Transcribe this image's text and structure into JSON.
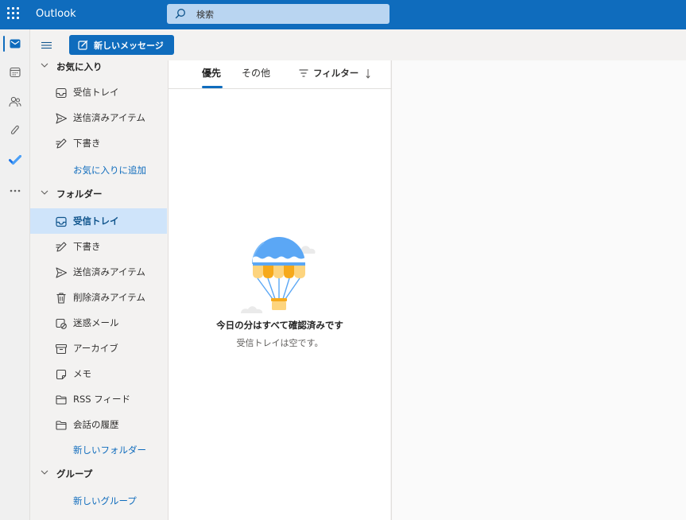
{
  "topbar": {
    "app_title": "Outlook",
    "search_placeholder": "検索",
    "bg_color": "#0f6cbd"
  },
  "rail": {
    "items": [
      {
        "name": "mail-icon",
        "active": true
      },
      {
        "name": "calendar-icon",
        "active": false
      },
      {
        "name": "people-icon",
        "active": false
      },
      {
        "name": "attachment-icon",
        "active": false
      },
      {
        "name": "todo-icon",
        "active": false
      },
      {
        "name": "more-apps-icon",
        "active": false
      }
    ]
  },
  "commands": {
    "new_message_label": "新しいメッセージ"
  },
  "folders": {
    "favorites_header": "お気に入り",
    "favorites": [
      {
        "label": "受信トレイ",
        "icon": "inbox-icon"
      },
      {
        "label": "送信済みアイテム",
        "icon": "send-icon"
      },
      {
        "label": "下書き",
        "icon": "drafts-icon"
      }
    ],
    "add_favorite_link": "お気に入りに追加",
    "folders_header": "フォルダー",
    "folder_items": [
      {
        "label": "受信トレイ",
        "icon": "inbox-icon",
        "selected": true
      },
      {
        "label": "下書き",
        "icon": "drafts-icon"
      },
      {
        "label": "送信済みアイテム",
        "icon": "send-icon"
      },
      {
        "label": "削除済みアイテム",
        "icon": "trash-icon"
      },
      {
        "label": "迷惑メール",
        "icon": "junk-icon"
      },
      {
        "label": "アーカイブ",
        "icon": "archive-icon"
      },
      {
        "label": "メモ",
        "icon": "notes-icon"
      },
      {
        "label": "RSS フィード",
        "icon": "folder-icon"
      },
      {
        "label": "会話の履歴",
        "icon": "folder-icon"
      }
    ],
    "new_folder_link": "新しいフォルダー",
    "groups_header": "グループ",
    "new_group_link": "新しいグループ"
  },
  "message_list": {
    "tabs": [
      {
        "label": "優先",
        "active": true
      },
      {
        "label": "その他",
        "active": false
      }
    ],
    "filter_label": "フィルター",
    "empty_title": "今日の分はすべて確認済みです",
    "empty_subtitle": "受信トレイは空です。"
  }
}
